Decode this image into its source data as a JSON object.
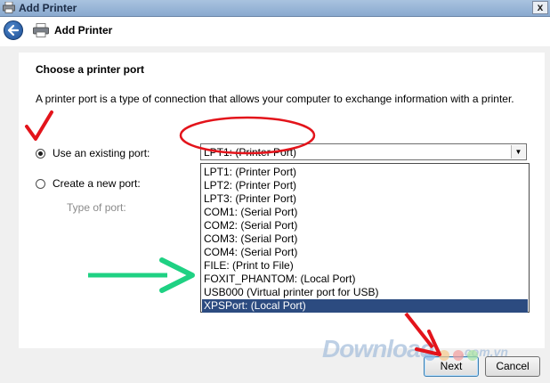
{
  "titlebar": {
    "title": "Add Printer",
    "close_label": "x"
  },
  "header": {
    "title": "Add Printer"
  },
  "main": {
    "heading": "Choose a printer port",
    "description": "A printer port is a type of connection that allows your computer to exchange information with a printer.",
    "existing_port": {
      "label": "Use an existing port:",
      "selected_value": "LPT1: (Printer Port)"
    },
    "new_port": {
      "label": "Create a new port:",
      "type_label": "Type of port:"
    },
    "port_options": [
      "LPT1: (Printer Port)",
      "LPT2: (Printer Port)",
      "LPT3: (Printer Port)",
      "COM1: (Serial Port)",
      "COM2: (Serial Port)",
      "COM3: (Serial Port)",
      "COM4: (Serial Port)",
      "FILE: (Print to File)",
      "FOXIT_PHANTOM: (Local Port)",
      "USB000 (Virtual printer port for USB)",
      "XPSPort: (Local Port)"
    ],
    "highlighted_option": "XPSPort: (Local Port)"
  },
  "watermark": {
    "text": "Download",
    "suffix": ".com.vn"
  },
  "footer": {
    "next_label": "Next",
    "cancel_label": "Cancel"
  },
  "colors": {
    "annotation_red": "#e3141b",
    "annotation_green": "#1fd183",
    "selection_blue": "#2c4b80"
  }
}
